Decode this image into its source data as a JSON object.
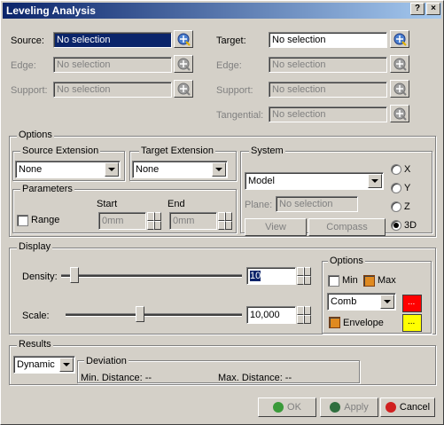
{
  "window": {
    "title": "Leveling Analysis",
    "help_label": "?",
    "close_label": "×"
  },
  "source": {
    "label": "Source:",
    "value": "No selection"
  },
  "edge1": {
    "label": "Edge:",
    "value": "No selection"
  },
  "support1": {
    "label": "Support:",
    "value": "No selection"
  },
  "target": {
    "label": "Target:",
    "value": "No selection"
  },
  "edge2": {
    "label": "Edge:",
    "value": "No selection"
  },
  "support2": {
    "label": "Support:",
    "value": "No selection"
  },
  "tangential": {
    "label": "Tangential:",
    "value": "No selection"
  },
  "options": {
    "title": "Options",
    "source_extension": {
      "label": "Source Extension",
      "value": "None"
    },
    "target_extension": {
      "label": "Target Extension",
      "value": "None"
    },
    "parameters": {
      "title": "Parameters",
      "start_label": "Start",
      "end_label": "End",
      "range_label": "Range",
      "start_value": "0mm",
      "end_value": "0mm"
    },
    "system": {
      "title": "System",
      "value": "Model",
      "plane_label": "Plane:",
      "plane_value": "No selection",
      "view_label": "View",
      "compass_label": "Compass",
      "radios": [
        {
          "label": "X",
          "checked": false
        },
        {
          "label": "Y",
          "checked": false
        },
        {
          "label": "Z",
          "checked": false
        },
        {
          "label": "3D",
          "checked": true
        }
      ]
    }
  },
  "display": {
    "title": "Display",
    "density_label": "Density:",
    "density_value": "10",
    "density_level": 0.05,
    "scale_label": "Scale:",
    "scale_value": "10,000",
    "scale_level": 0.42,
    "options": {
      "title": "Options",
      "min_label": "Min",
      "max_label": "Max",
      "mode_value": "Comb",
      "envelope_label": "Envelope",
      "colors": {
        "primary": "#ff0000",
        "secondary": "#ffff00"
      },
      "color_dots": "..."
    }
  },
  "results": {
    "title": "Results",
    "mode_value": "Dynamic",
    "deviation_title": "Deviation",
    "min_distance": "Min. Distance: --",
    "max_distance": "Max. Distance: --"
  },
  "buttons": {
    "ok": "OK",
    "apply": "Apply",
    "cancel": "Cancel"
  }
}
